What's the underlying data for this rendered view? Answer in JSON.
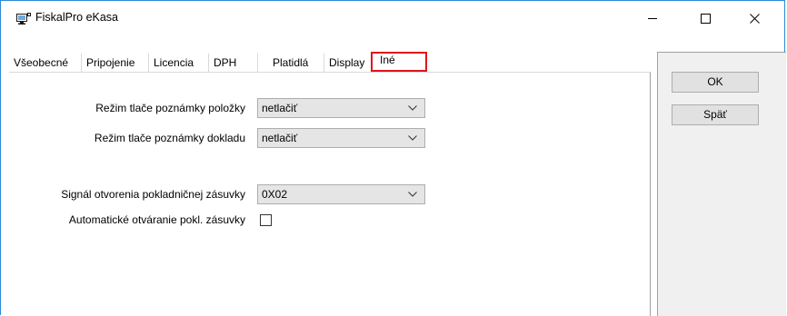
{
  "window": {
    "title": "FiskalPro eKasa",
    "icon": "monitor-icon"
  },
  "tabs": [
    {
      "label": "Všeobecné"
    },
    {
      "label": "Pripojenie"
    },
    {
      "label": "Licencia"
    },
    {
      "label": "DPH"
    },
    {
      "label": "Platidlá"
    },
    {
      "label": "Display"
    },
    {
      "label": "Iné",
      "active": true
    }
  ],
  "form": {
    "item_note_label": "Režim tlače poznámky položky",
    "item_note_value": "netlačiť",
    "doc_note_label": "Režim tlače poznámky dokladu",
    "doc_note_value": "netlačiť",
    "drawer_signal_label": "Signál otvorenia pokladničnej zásuvky",
    "drawer_signal_value": "0X02",
    "auto_open_label": "Automatické otváranie pokl. zásuvky",
    "auto_open_checked": false
  },
  "buttons": {
    "ok": "OK",
    "back": "Späť"
  },
  "colors": {
    "window_border": "#2b8ad6",
    "active_tab_highlight": "#e1141a",
    "panel_bg": "#f0f0f0"
  }
}
